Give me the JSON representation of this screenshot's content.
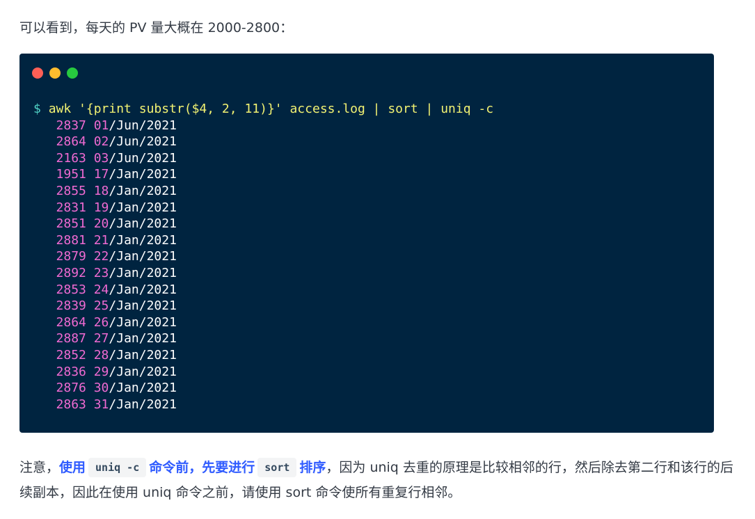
{
  "intro": {
    "text": "可以看到，每天的 PV 量大概在 2000-2800："
  },
  "window": {
    "dot_colors": [
      "#ff5f56",
      "#ffbd2e",
      "#27c93f"
    ]
  },
  "code": {
    "prompt": "$",
    "command": "awk '{print substr($4, 2, 11)}' access.log | sort | uniq -c",
    "rows": [
      {
        "count": "2837",
        "day": "01",
        "rest": "/Jun/2021"
      },
      {
        "count": "2864",
        "day": "02",
        "rest": "/Jun/2021"
      },
      {
        "count": "2163",
        "day": "03",
        "rest": "/Jun/2021"
      },
      {
        "count": "1951",
        "day": "17",
        "rest": "/Jan/2021"
      },
      {
        "count": "2855",
        "day": "18",
        "rest": "/Jan/2021"
      },
      {
        "count": "2831",
        "day": "19",
        "rest": "/Jan/2021"
      },
      {
        "count": "2851",
        "day": "20",
        "rest": "/Jan/2021"
      },
      {
        "count": "2881",
        "day": "21",
        "rest": "/Jan/2021"
      },
      {
        "count": "2879",
        "day": "22",
        "rest": "/Jan/2021"
      },
      {
        "count": "2892",
        "day": "23",
        "rest": "/Jan/2021"
      },
      {
        "count": "2853",
        "day": "24",
        "rest": "/Jan/2021"
      },
      {
        "count": "2839",
        "day": "25",
        "rest": "/Jan/2021"
      },
      {
        "count": "2864",
        "day": "26",
        "rest": "/Jan/2021"
      },
      {
        "count": "2887",
        "day": "27",
        "rest": "/Jan/2021"
      },
      {
        "count": "2852",
        "day": "28",
        "rest": "/Jan/2021"
      },
      {
        "count": "2836",
        "day": "29",
        "rest": "/Jan/2021"
      },
      {
        "count": "2876",
        "day": "30",
        "rest": "/Jan/2021"
      },
      {
        "count": "2863",
        "day": "31",
        "rest": "/Jan/2021"
      }
    ]
  },
  "note": {
    "lead": "注意，",
    "hl_1": "使用",
    "code_1": "uniq -c",
    "hl_2": "命令前，先要进行",
    "code_2": "sort",
    "hl_3": "排序",
    "tail": "，因为 uniq 去重的原理是比较相邻的行，然后除去第二行和该行的后续副本，因此在使用 uniq 命令之前，请使用 sort 命令使所有重复行相邻。"
  }
}
